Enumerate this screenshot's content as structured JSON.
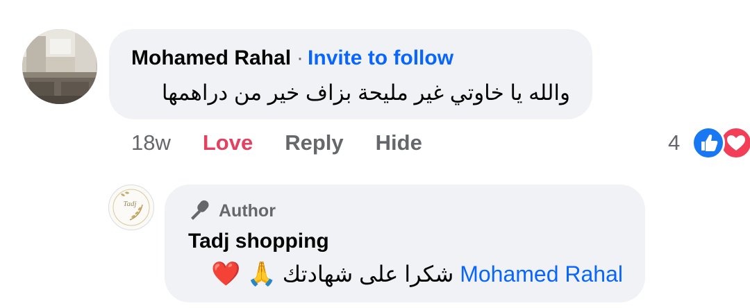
{
  "comment": {
    "author_name": "Mohamed Rahal",
    "separator": "·",
    "invite_label": "Invite to follow",
    "text": "والله يا خاوتي غير مليحة بزاف  خير من دراهمها",
    "time": "18w",
    "love_label": "Love",
    "reply_label": "Reply",
    "hide_label": "Hide",
    "reaction_count": "4",
    "reaction_icons": [
      "like-icon",
      "love-icon"
    ],
    "love_color": "#e4405f"
  },
  "reply": {
    "badge_icon": "microphone-icon",
    "badge_label": "Author",
    "author_name": "Tadj shopping",
    "avatar_logo_text": "Tadj",
    "mention": "Mohamed Rahal",
    "text": "شكرا على شهادتك",
    "emoji_pray": "🙏",
    "emoji_heart": "❤️"
  },
  "colors": {
    "link_blue": "#0866ff",
    "bubble_bg": "#f0f2f5",
    "secondary_text": "#65676b"
  }
}
